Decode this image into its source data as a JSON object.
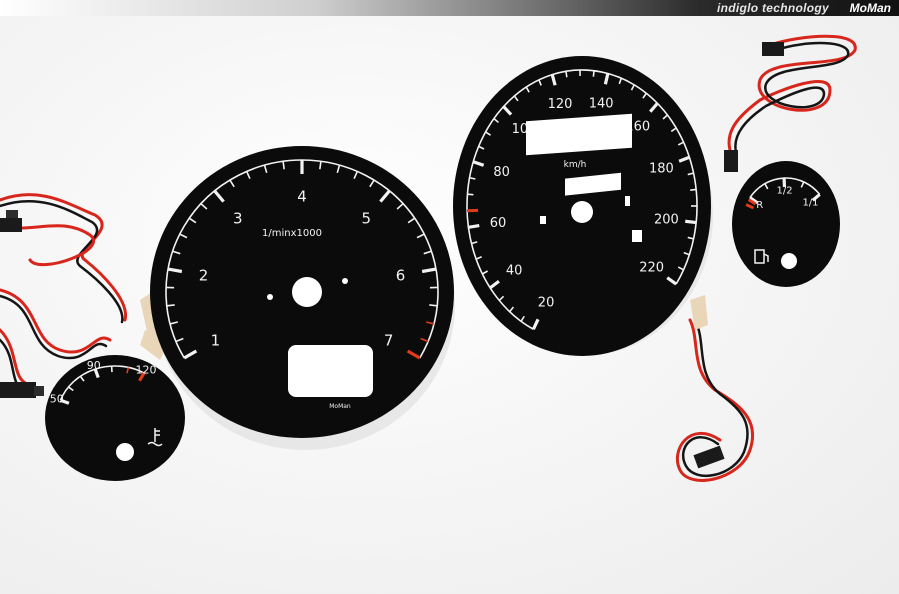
{
  "banner": {
    "tagline": "indiglo technology",
    "brand": "MoMan"
  },
  "tachometer": {
    "scale_labels": [
      "1",
      "2",
      "3",
      "4",
      "5",
      "6",
      "7"
    ],
    "unit_label": "1/minx1000",
    "maker_mark": "MoMan",
    "redline_from": "6.5"
  },
  "speedometer": {
    "scale_labels": [
      "20",
      "40",
      "60",
      "80",
      "100",
      "120",
      "140",
      "160",
      "180",
      "200",
      "220"
    ],
    "unit_label": "km/h"
  },
  "temperature_gauge": {
    "scale_labels": [
      "50",
      "90",
      "120"
    ],
    "icon": "coolant-temperature-icon"
  },
  "fuel_gauge": {
    "scale_labels": [
      "R",
      "1/2",
      "1/1"
    ],
    "icon": "fuel-pump-icon"
  },
  "colors": {
    "dial": "#0b0b0b",
    "markings": "#f2f2f2",
    "redline": "#e23a1c",
    "wire_red": "#d8261c",
    "wire_black": "#151515"
  }
}
